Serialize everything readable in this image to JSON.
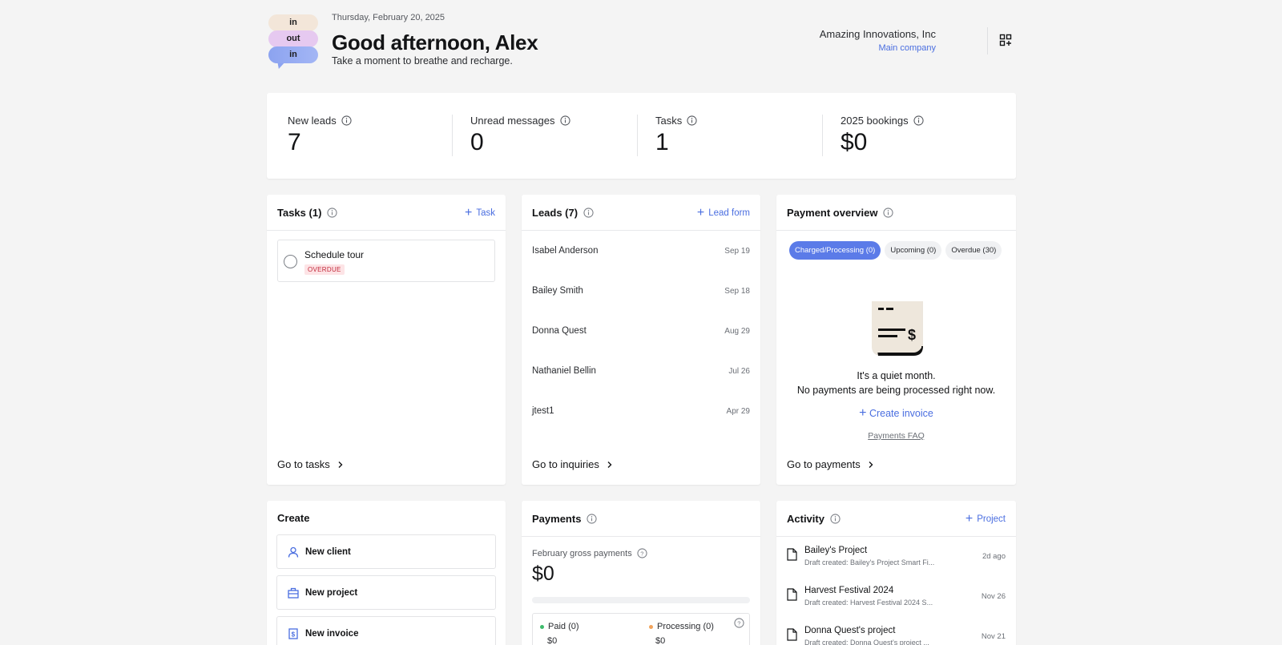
{
  "header": {
    "logo_pills": [
      "in",
      "out",
      "in"
    ],
    "date": "Thursday, February 20, 2025",
    "greeting": "Good afternoon, Alex",
    "subtitle": "Take a moment to breathe and recharge.",
    "company_name": "Amazing Innovations, Inc",
    "company_sub": "Main company"
  },
  "stats": [
    {
      "label": "New leads",
      "value": "7"
    },
    {
      "label": "Unread messages",
      "value": "0"
    },
    {
      "label": "Tasks",
      "value": "1"
    },
    {
      "label": "2025 bookings",
      "value": "$0"
    }
  ],
  "tasks": {
    "title": "Tasks (1)",
    "action": "Task",
    "items": [
      {
        "name": "Schedule tour",
        "badge": "OVERDUE"
      }
    ],
    "footer": "Go to tasks"
  },
  "leads": {
    "title": "Leads (7)",
    "action": "Lead form",
    "items": [
      {
        "name": "Isabel Anderson",
        "date": "Sep 19"
      },
      {
        "name": "Bailey Smith",
        "date": "Sep 18"
      },
      {
        "name": "Donna Quest",
        "date": "Aug 29"
      },
      {
        "name": "Nathaniel Bellin",
        "date": "Jul 26"
      },
      {
        "name": "jtest1",
        "date": "Apr 29"
      }
    ],
    "footer": "Go to inquiries"
  },
  "payment_overview": {
    "title": "Payment overview",
    "chips": [
      "Charged/Processing (0)",
      "Upcoming (0)",
      "Overdue (30)"
    ],
    "empty_line1": "It's a quiet month.",
    "empty_line2": "No payments are being processed right now.",
    "create_invoice": "Create invoice",
    "faq": "Payments FAQ",
    "footer": "Go to payments"
  },
  "create": {
    "title": "Create",
    "buttons": [
      "New client",
      "New project",
      "New invoice"
    ]
  },
  "payments": {
    "title": "Payments",
    "subtitle": "February gross payments",
    "total": "$0",
    "paid_label": "Paid (0)",
    "paid_amount": "$0",
    "processing_label": "Processing (0)",
    "processing_amount": "$0"
  },
  "activity": {
    "title": "Activity",
    "action": "Project",
    "items": [
      {
        "title": "Bailey's Project",
        "desc": "Draft created: Bailey's Project Smart Fi...",
        "time": "2d ago"
      },
      {
        "title": "Harvest Festival 2024",
        "desc": "Draft created: Harvest Festival 2024 S...",
        "time": "Nov 26"
      },
      {
        "title": "Donna Quest's project",
        "desc": "Draft created: Donna Quest's project ...",
        "time": "Nov 21"
      }
    ]
  },
  "colors": {
    "accent": "#4a6ee0",
    "chip_active": "#5b7be8",
    "overdue": "#c2283a",
    "paid_dot": "#3dbb6b",
    "processing_dot": "#f2a35b"
  }
}
